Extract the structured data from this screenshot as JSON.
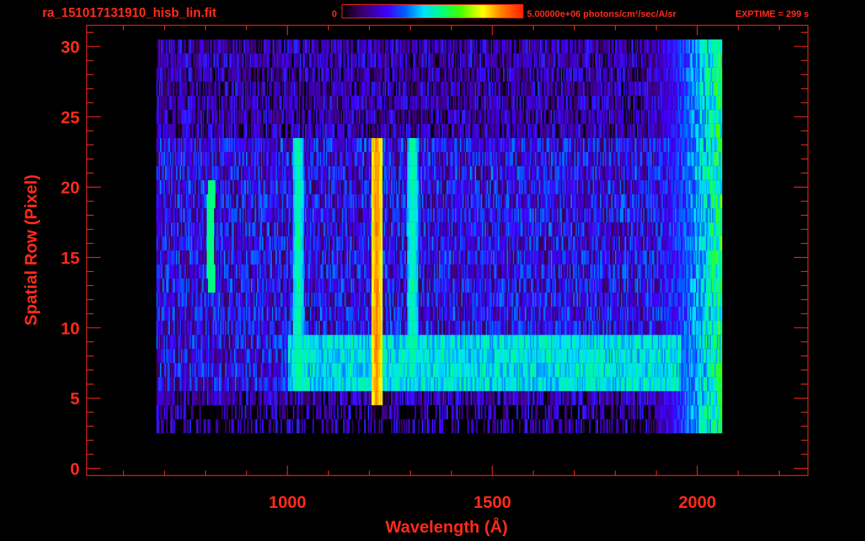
{
  "header": {
    "filename": "ra_151017131910_hisb_lin.fit",
    "colorbar_min": "0",
    "colorbar_max": "5.00000e+06 photons/cm²/sec/A/sr",
    "exptime": "EXPTIME = 299 s"
  },
  "colors": {
    "axis": "#ff2a1a",
    "background": "#000000"
  },
  "chart_data": {
    "type": "heatmap",
    "title": "ra_151017131910_hisb_lin.fit",
    "xlabel": "Wavelength (Å)",
    "ylabel": "Spatial Row (Pixel)",
    "xlim": [
      510,
      2270
    ],
    "ylim": [
      -0.5,
      31.5
    ],
    "xticks": [
      1000,
      1500,
      2000
    ],
    "yticks": [
      0,
      5,
      10,
      15,
      20,
      25,
      30
    ],
    "colorbar": {
      "min": 0,
      "max": 5000000,
      "colormap": "rainbow",
      "units": "photons/cm²/sec/A/sr"
    },
    "exptime_s": 299,
    "features": [
      {
        "kind": "emission_line",
        "x_wavelength": 1216,
        "rows": [
          5,
          23
        ],
        "level": 0.85
      },
      {
        "kind": "emission_line",
        "x_wavelength": 1304,
        "rows": [
          7,
          23
        ],
        "level": 0.5
      },
      {
        "kind": "emission_line",
        "x_wavelength": 1025,
        "rows": [
          6,
          23
        ],
        "level": 0.5
      },
      {
        "kind": "arc",
        "x_wavelength": 820,
        "rows": [
          13,
          20
        ],
        "level": 0.55
      },
      {
        "kind": "band",
        "x_range": [
          1000,
          1960
        ],
        "rows": [
          6,
          9
        ],
        "level": 0.5
      },
      {
        "kind": "continuum_rise",
        "x_range": [
          1850,
          2060
        ],
        "rows": [
          3,
          30
        ],
        "level": 0.6
      }
    ],
    "data_extent": {
      "x_range": [
        680,
        2060
      ],
      "rows": [
        3,
        30
      ]
    }
  }
}
